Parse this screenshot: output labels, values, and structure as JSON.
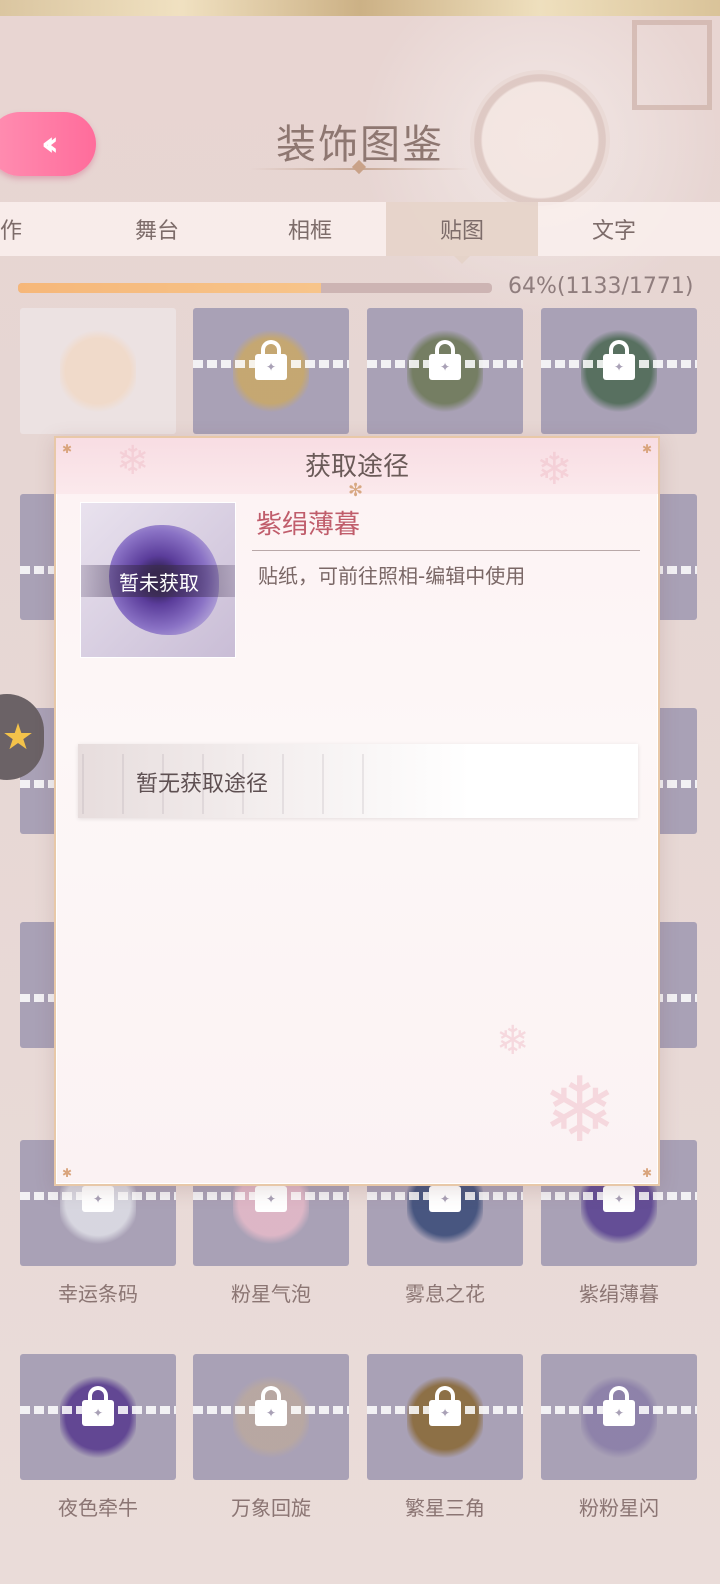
{
  "header": {
    "title": "装饰图鉴",
    "back_icon": "double-chevron-left"
  },
  "tabs": [
    {
      "label": "动作"
    },
    {
      "label": "舞台"
    },
    {
      "label": "相框"
    },
    {
      "label": "贴图",
      "active": true
    },
    {
      "label": "文字"
    }
  ],
  "progress": {
    "fraction": 0.64,
    "label": "64%(1133/1771)"
  },
  "grid": {
    "rows": [
      {
        "items": [
          {
            "name": "",
            "locked": false,
            "art_color": "#f1d9c7"
          },
          {
            "name": "",
            "locked": true,
            "art_color": "#c8a86a"
          },
          {
            "name": "",
            "locked": true,
            "art_color": "#6f7a5a"
          },
          {
            "name": "",
            "locked": true,
            "art_color": "#4f6b57"
          }
        ]
      },
      {
        "items": [
          {
            "name": "幸运条码",
            "locked": true,
            "art_color": "#dcdce4"
          },
          {
            "name": "粉星气泡",
            "locked": true,
            "art_color": "#e3b9c8"
          },
          {
            "name": "雾息之花",
            "locked": true,
            "art_color": "#3d4e7a"
          },
          {
            "name": "紫绢薄暮",
            "locked": true,
            "art_color": "#5c4592"
          }
        ]
      },
      {
        "items": [
          {
            "name": "夜色牵牛",
            "locked": true,
            "art_color": "#5a3d8f"
          },
          {
            "name": "万象回旋",
            "locked": true,
            "art_color": "#b9a8a0"
          },
          {
            "name": "繁星三角",
            "locked": true,
            "art_color": "#8a6a3a"
          },
          {
            "name": "粉粉星闪",
            "locked": true,
            "art_color": "#8b7fa8"
          }
        ]
      }
    ]
  },
  "modal": {
    "title": "获取途径",
    "item_name": "紫绢薄暮",
    "status_banner": "暂未获取",
    "description": "贴纸，可前往照相-编辑中使用",
    "no_source_text": "暂无获取途径"
  },
  "colors": {
    "accent_pink": "#ff6c9b",
    "progress_fill": "#f6b779",
    "item_name": "#c05d6b"
  }
}
